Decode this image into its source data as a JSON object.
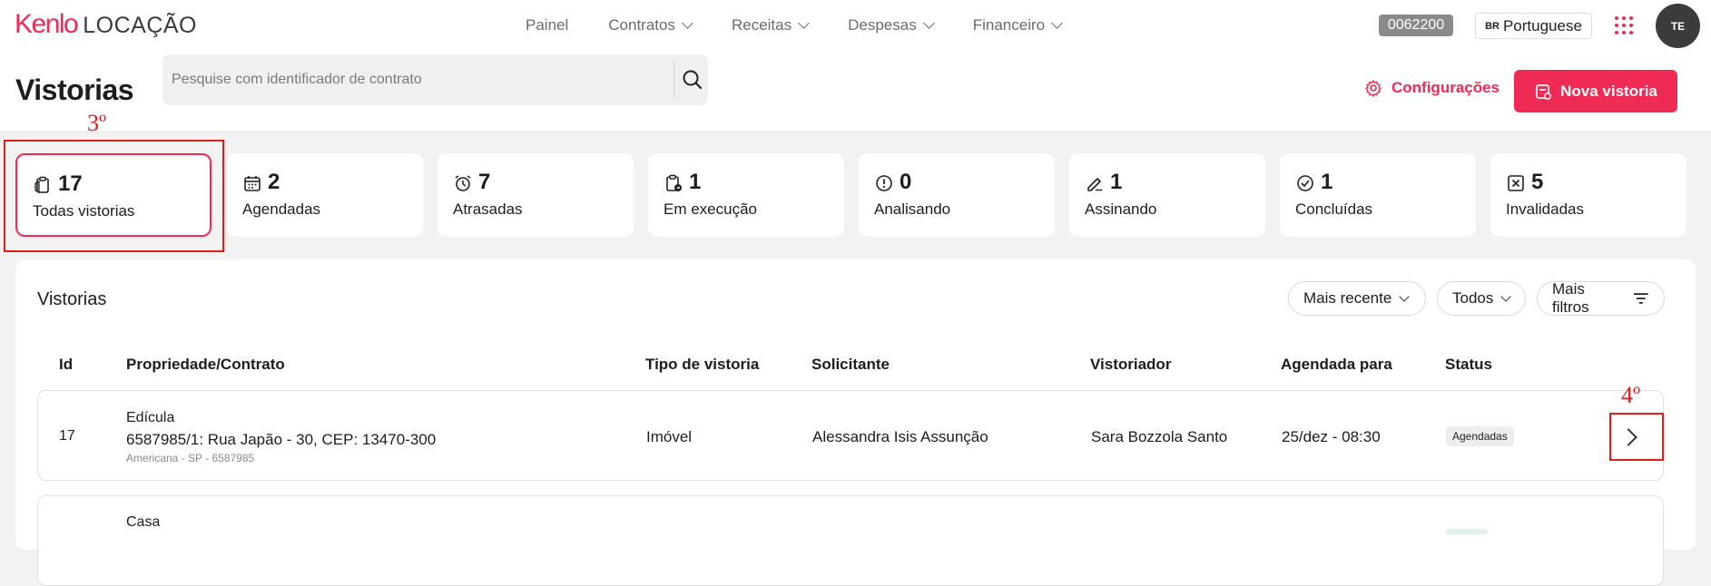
{
  "brand": {
    "name": "Kenlo",
    "product": "LOCAÇÃO"
  },
  "nav": [
    {
      "label": "Painel",
      "dropdown": false
    },
    {
      "label": "Contratos",
      "dropdown": true
    },
    {
      "label": "Receitas",
      "dropdown": true
    },
    {
      "label": "Despesas",
      "dropdown": true
    },
    {
      "label": "Financeiro",
      "dropdown": true
    }
  ],
  "account_code": "0062200",
  "language": {
    "flag": "BR",
    "label": "Portuguese"
  },
  "user_initials": "TE",
  "page": {
    "title": "Vistorias",
    "search_placeholder": "Pesquise com identificador de contrato",
    "config_label": "Configurações",
    "new_button_label": "Nova vistoria"
  },
  "annotations": {
    "step_cards": "3º",
    "step_arrow": "4º"
  },
  "stat_cards": [
    {
      "count": "17",
      "label": "Todas vistorias",
      "icon": "clipboard-icon",
      "active": true
    },
    {
      "count": "2",
      "label": "Agendadas",
      "icon": "calendar-icon",
      "active": false
    },
    {
      "count": "7",
      "label": "Atrasadas",
      "icon": "alarm-clock-icon",
      "active": false
    },
    {
      "count": "1",
      "label": "Em execução",
      "icon": "clipboard-progress-icon",
      "active": false
    },
    {
      "count": "0",
      "label": "Analisando",
      "icon": "alert-circle-icon",
      "active": false
    },
    {
      "count": "1",
      "label": "Assinando",
      "icon": "signature-pen-icon",
      "active": false
    },
    {
      "count": "1",
      "label": "Concluídas",
      "icon": "check-circle-icon",
      "active": false
    },
    {
      "count": "5",
      "label": "Invalidadas",
      "icon": "x-square-icon",
      "active": false
    }
  ],
  "table": {
    "title": "Vistorias",
    "filters": {
      "sort": "Mais recente",
      "scope": "Todos",
      "more": "Mais filtros"
    },
    "columns": [
      "Id",
      "Propriedade/Contrato",
      "Tipo de vistoria",
      "Solicitante",
      "Vistoriador",
      "Agendada para",
      "Status"
    ],
    "rows": [
      {
        "id": "17",
        "property_name": "Edícula",
        "contract": "6587985/1: Rua Japão - 30, CEP: 13470-300",
        "location": "Americana - SP - 6587985",
        "type": "Imóvel",
        "requester": "Alessandra Isis Assunção",
        "inspector": "Sara Bozzola Santo",
        "scheduled": "25/dez - 08:30",
        "status": "Agendadas"
      },
      {
        "id": "",
        "property_name": "Casa",
        "contract": "",
        "location": "",
        "type": "",
        "requester": "",
        "inspector": "",
        "scheduled": "",
        "status": ""
      }
    ]
  },
  "colors": {
    "accent": "#ee2a55",
    "annotation": "#e01b1b",
    "background": "#f2f2f2"
  }
}
